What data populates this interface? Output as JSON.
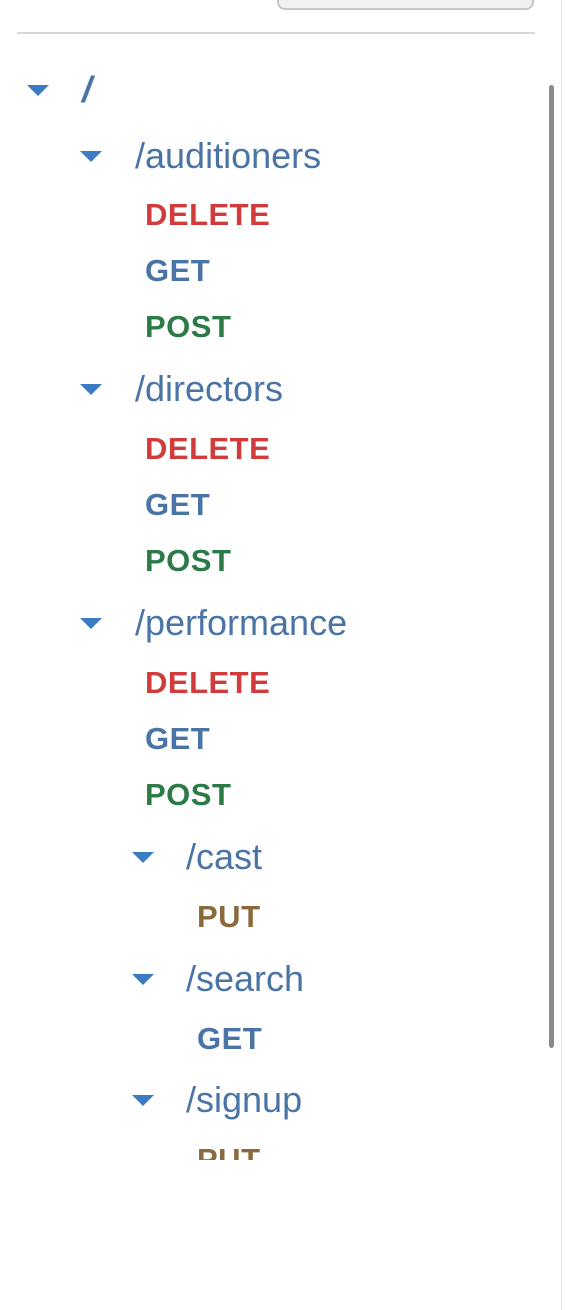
{
  "colors": {
    "path": "#4a74a6",
    "toggle": "#3a7bc4",
    "DELETE": "#d13b3b",
    "GET": "#4a74a6",
    "POST": "#2c7a45",
    "PUT": "#8a6a3c"
  },
  "tree": {
    "root": {
      "label": "/"
    },
    "auditioners": {
      "label": "/auditioners",
      "methods": [
        "DELETE",
        "GET",
        "POST"
      ]
    },
    "directors": {
      "label": "/directors",
      "methods": [
        "DELETE",
        "GET",
        "POST"
      ]
    },
    "performance": {
      "label": "/performance",
      "methods": [
        "DELETE",
        "GET",
        "POST"
      ],
      "cast": {
        "label": "/cast",
        "methods": [
          "PUT"
        ]
      },
      "search": {
        "label": "/search",
        "methods": [
          "GET"
        ]
      },
      "signup": {
        "label": "/signup",
        "methods": [
          "PUT"
        ]
      }
    }
  }
}
